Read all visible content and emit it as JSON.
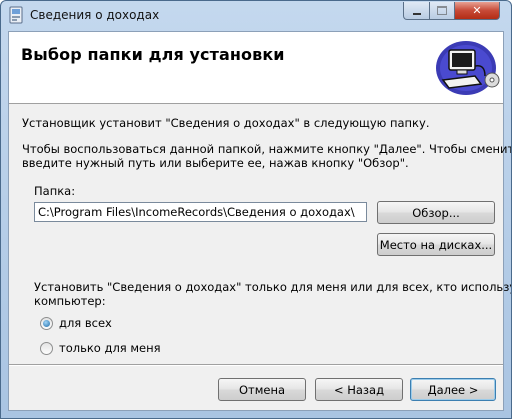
{
  "window": {
    "title": "Сведения о доходах"
  },
  "header": {
    "title": "Выбор папки для установки"
  },
  "intro_text": "Установщик установит \"Сведения о доходах\" в следующую папку.",
  "instructions_line1": "Чтобы воспользоваться данной папкой, нажмите кнопку \"Далее\". Чтобы сменить папку,",
  "instructions_line2": "введите нужный путь или выберите ее, нажав кнопку \"Обзор\".",
  "folder": {
    "label": "Папка:",
    "value": "C:\\Program Files\\IncomeRecords\\Сведения о доходах\\"
  },
  "buttons": {
    "browse": "Обзор...",
    "disk_cost": "Место на дисках...",
    "cancel": "Отмена",
    "back": "< Назад",
    "next": "Далее >"
  },
  "install_for": {
    "line1": "Установить \"Сведения о доходах\" только для меня или для всех, кто использует этот",
    "line2": "компьютер:",
    "options": [
      {
        "label": "для всех",
        "checked": true
      },
      {
        "label": "только для меня",
        "checked": false
      }
    ]
  }
}
